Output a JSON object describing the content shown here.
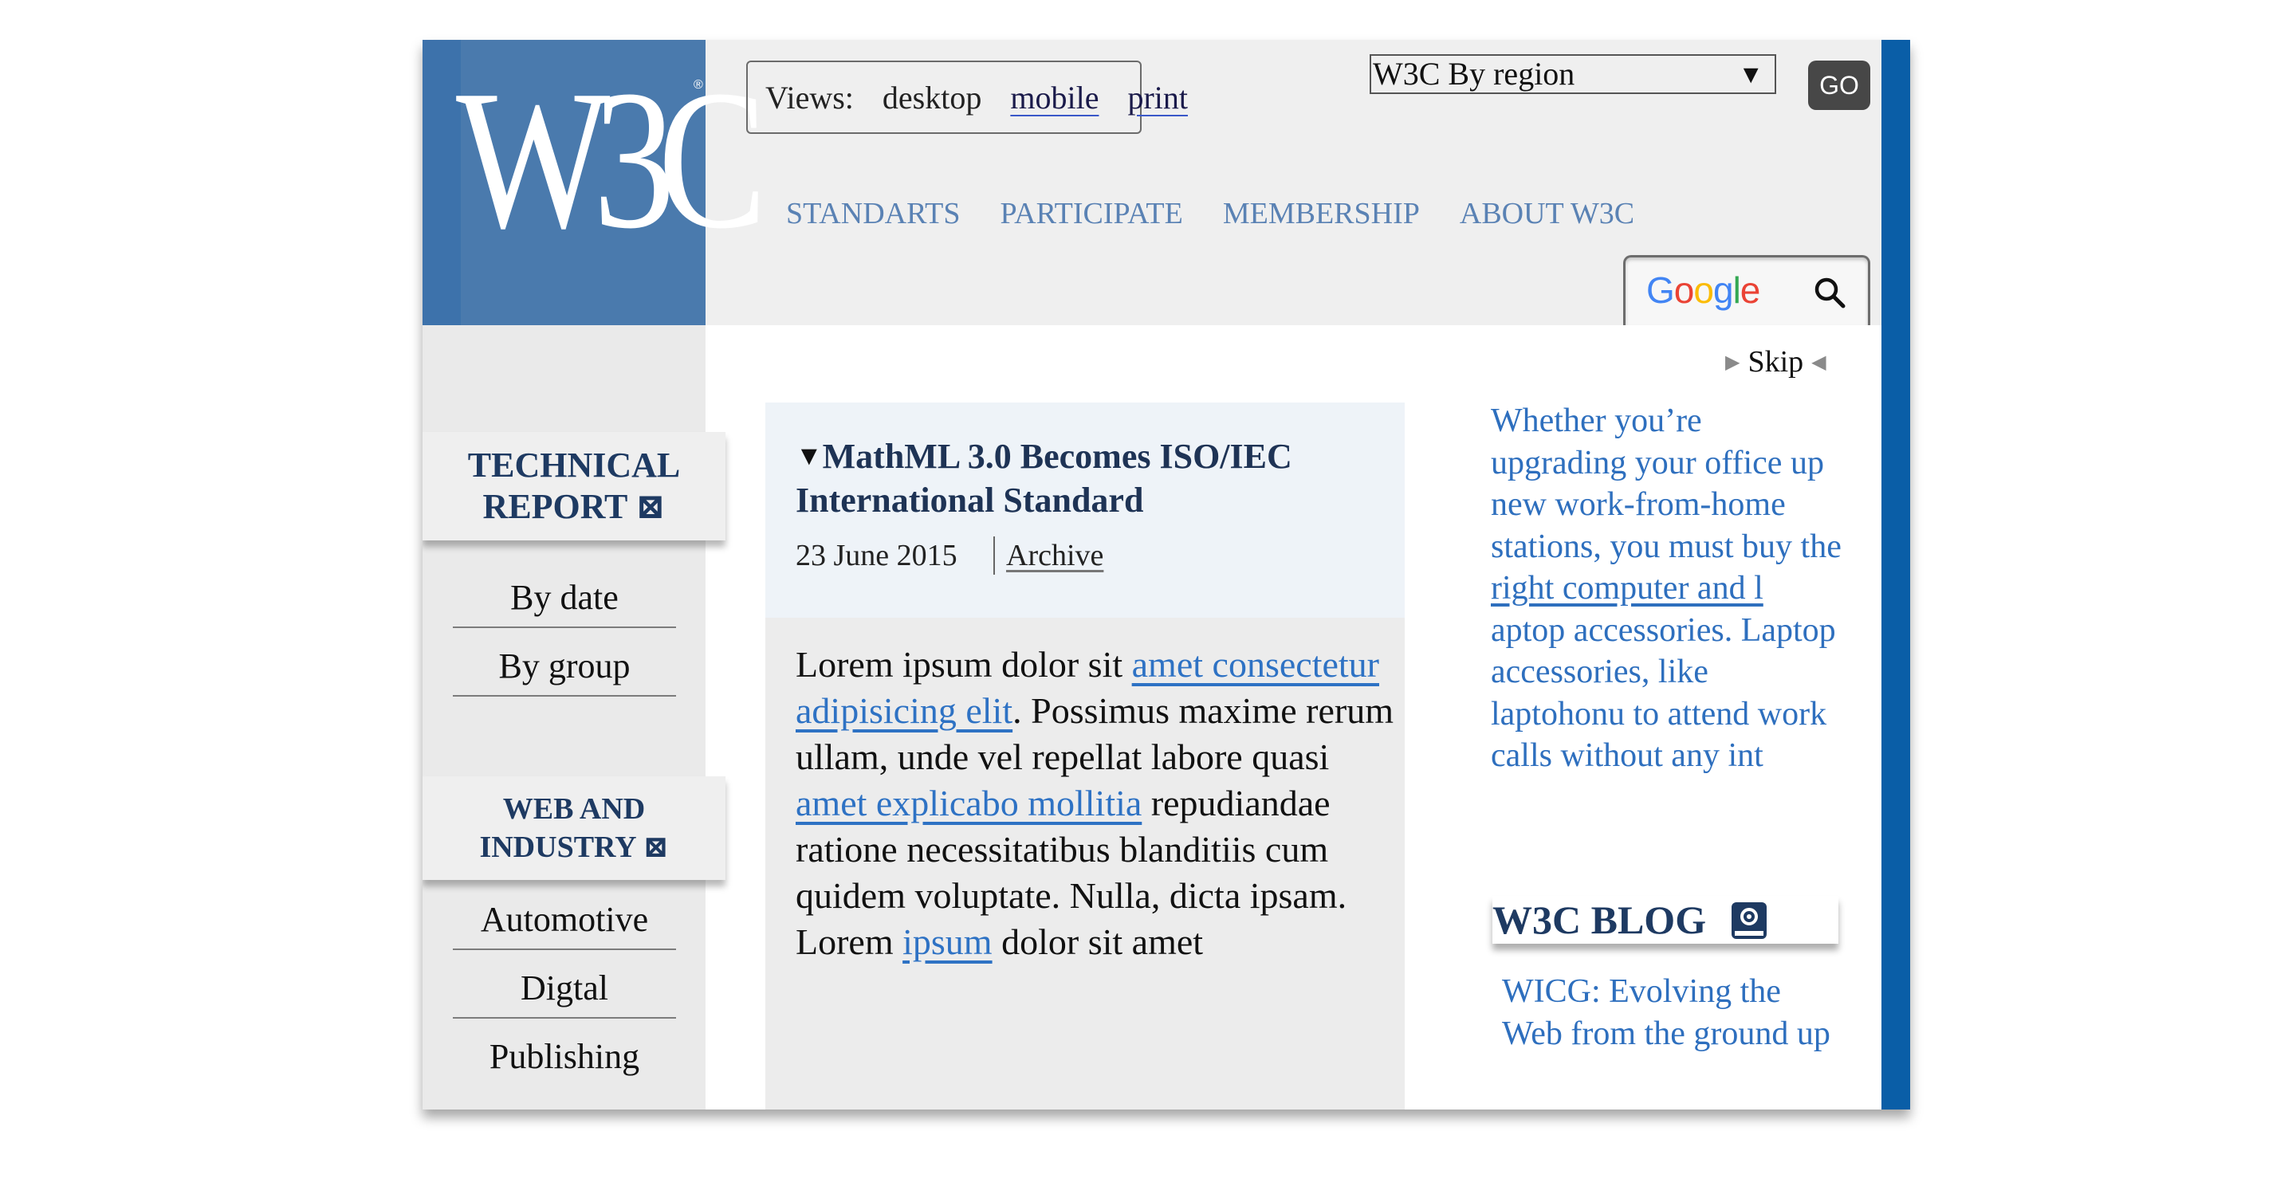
{
  "logo": {
    "text": "W3C",
    "reg": "®"
  },
  "views": {
    "label": "Views:",
    "current": "desktop",
    "links": [
      "mobile",
      "print"
    ]
  },
  "region": {
    "selected": "W3C By region",
    "go_label": "GO"
  },
  "nav": [
    "STANDARTS",
    "PARTICIPATE",
    "MEMBERSHIP",
    "ABOUT W3C"
  ],
  "search": {
    "logo": "Google",
    "icon": "search-icon"
  },
  "skip": "Skip",
  "sidebar": {
    "technical_report": {
      "line1": "TECHNICAL",
      "line2": "REPORT",
      "icon": "⊠"
    },
    "technical_links": [
      "By date",
      "By group"
    ],
    "web_industry": {
      "line1": "WEB AND",
      "line2": "INDUSTRY",
      "icon": "⊠"
    },
    "industry_links": [
      "Automotive",
      "Digtal",
      "Publishing"
    ]
  },
  "article": {
    "title": "MathML 3.0 Becomes ISO/IEC International Standard",
    "date": "23 June 2015",
    "archive": "Archive",
    "p1": "Lorem ipsum dolor sit ",
    "p1_link": "amet consectetur adipisicing elit",
    "p2": ". Possimus maxime rerum ullam, unde vel repellat labore quasi ",
    "p2_link": "amet explicabo mollitia",
    "p3": " repudiandae ratione necessitatibus blanditiis cum quidem voluptate. Nulla, dicta ipsam.",
    "p4": "Lorem ",
    "p4_link": "ipsum",
    "p5": " dolor sit amet"
  },
  "promo": {
    "t1": "Whether you’re upgrading your office up new work-from-home stations, you must buy the ",
    "link": "right computer and l",
    "t2": " aptop accessories. Laptop accessories, like laptohonu to attend work calls without any int"
  },
  "blog": {
    "title": "W3C BLOG",
    "post": "WICG: Evolving the Web from the ground up"
  },
  "colors": {
    "brand_blue": "#4a7aad",
    "stripe_blue": "#0a5ea7",
    "nav_blue": "#5a82b4",
    "link_blue": "#2e72c4",
    "heading_navy": "#1e3a62"
  }
}
